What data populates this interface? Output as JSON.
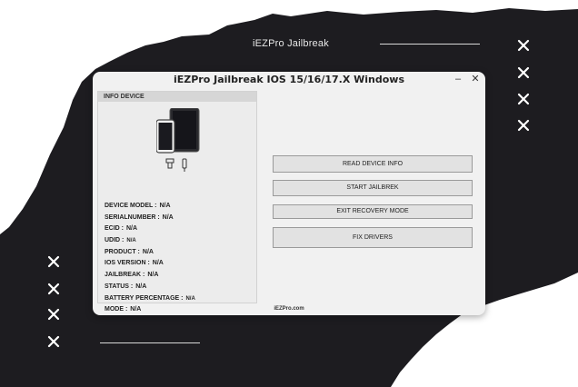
{
  "banner": {
    "title": "iEZPro Jailbreak"
  },
  "window": {
    "title": "iEZPro Jailbreak IOS 15/16/17.X Windows",
    "minimize_label": "–",
    "close_label": "✕",
    "footer": "iEZPro.com"
  },
  "device_panel": {
    "header": "INFO DEVICE",
    "fields": [
      {
        "label": "DEVICE MODEL :",
        "value": "N/A"
      },
      {
        "label": "SERIALNUMBER :",
        "value": "N/A"
      },
      {
        "label": "ECID :",
        "value": "N/A"
      },
      {
        "label": "UDID :",
        "value": "N/A"
      },
      {
        "label": "PRODUCT :",
        "value": "N/A"
      },
      {
        "label": "IOS VERSION :",
        "value": "N/A"
      },
      {
        "label": "JAILBREAK :",
        "value": "N/A"
      },
      {
        "label": "STATUS :",
        "value": "N/A"
      },
      {
        "label": "BATTERY PERCENTAGE :",
        "value": "N/A"
      },
      {
        "label": "MODE :",
        "value": "N/A"
      }
    ]
  },
  "actions": {
    "read_device_info": "READ DEVICE INFO",
    "start_jailbreak": "START JAILBREK",
    "exit_recovery_mode": "EXIT RECOVERY MODE",
    "fix_drivers": "FIX DRIVERS"
  },
  "icons": {
    "close_x": "close-x-icon",
    "devices": "devices-icon",
    "cables": "cable-icon"
  },
  "colors": {
    "background": "#1d1c20",
    "torn_paper": "#ffffff",
    "window": "#f1f1f1",
    "button": "#e2e2e2"
  }
}
